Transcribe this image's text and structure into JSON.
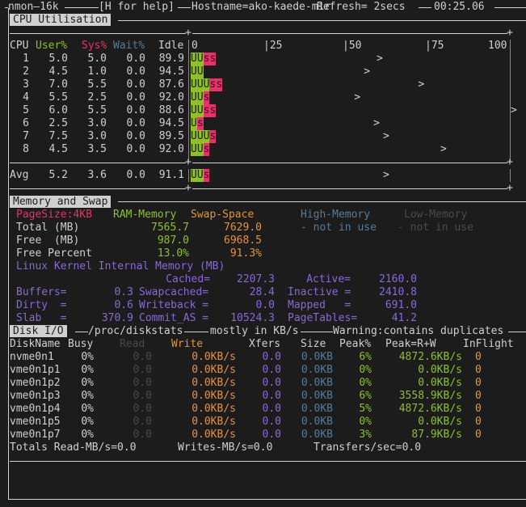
{
  "titlebar": {
    "app": "nmon—16k",
    "help": "[H for help]",
    "hostname": "Hostname=ako-kaede-mir",
    "refresh": "Refresh= 2secs",
    "time": "00:25.06"
  },
  "cpu": {
    "section_title": "CPU Utilisation",
    "headers": {
      "cpu": "CPU",
      "user": "User%",
      "sys": "Sys%",
      "wait": "Wait%",
      "idle": "Idle"
    },
    "scale": [
      "0",
      "|25",
      "|50",
      "|75",
      "100"
    ],
    "rows": [
      {
        "cpu": "1",
        "user": "5.0",
        "sys": "5.0",
        "wait": "0.0",
        "idle": "89.9",
        "bar_u": "UU",
        "bar_s": "ss",
        "peak_pct": 59
      },
      {
        "cpu": "2",
        "user": "4.5",
        "sys": "1.0",
        "wait": "0.0",
        "idle": "94.5",
        "bar_u": "UU",
        "bar_s": "",
        "peak_pct": 55
      },
      {
        "cpu": "3",
        "user": "7.0",
        "sys": "5.5",
        "wait": "0.0",
        "idle": "87.6",
        "bar_u": "UUU",
        "bar_s": "ss",
        "peak_pct": 72
      },
      {
        "cpu": "4",
        "user": "5.5",
        "sys": "2.5",
        "wait": "0.0",
        "idle": "92.0",
        "bar_u": "UU",
        "bar_s": "s",
        "peak_pct": 52
      },
      {
        "cpu": "5",
        "user": "6.0",
        "sys": "5.5",
        "wait": "0.0",
        "idle": "88.6",
        "bar_u": "UU",
        "bar_s": "ss",
        "peak_pct": 101
      },
      {
        "cpu": "6",
        "user": "2.5",
        "sys": "3.0",
        "wait": "0.0",
        "idle": "94.5",
        "bar_u": "U",
        "bar_s": "s",
        "peak_pct": 58
      },
      {
        "cpu": "7",
        "user": "7.5",
        "sys": "3.0",
        "wait": "0.0",
        "idle": "89.5",
        "bar_u": "UUU",
        "bar_s": "s",
        "peak_pct": 61
      },
      {
        "cpu": "8",
        "user": "4.5",
        "sys": "3.5",
        "wait": "0.0",
        "idle": "92.0",
        "bar_u": "UU",
        "bar_s": "s",
        "peak_pct": 79
      }
    ],
    "avg": {
      "label": "Avg",
      "user": "5.2",
      "sys": "3.6",
      "wait": "0.0",
      "idle": "91.1",
      "bar_u": "UU",
      "bar_s": "s",
      "peak_pct": 61
    },
    "peak_marker": ">"
  },
  "memory": {
    "section_title": "Memory and Swap",
    "pagesize": "PageSize:4KB",
    "ram_header": "RAM-Memory",
    "swap_header": "Swap-Space",
    "high_header": "High-Memory",
    "low_header": "Low-Memory",
    "high_value": "- not in use",
    "low_value": "- not in use",
    "rows": [
      {
        "label": "Total (MB)",
        "ram": "7565.7",
        "swap": "7629.0"
      },
      {
        "label": "Free  (MB)",
        "ram": "987.0",
        "swap": "6968.5"
      },
      {
        "label": "Free Percent",
        "ram": "13.0%",
        "swap": "91.3%"
      }
    ],
    "kernel_title": "Linux Kernel Internal Memory (MB)",
    "kernel": [
      [
        {
          "label": "",
          "value": ""
        },
        {
          "label": "Cached=",
          "value": "2207.3"
        },
        {
          "label": "Active=",
          "value": "2160.0"
        }
      ],
      [
        {
          "label": "Buffers=",
          "value": "0.3"
        },
        {
          "label": "Swapcached=",
          "value": "28.4"
        },
        {
          "label": "Inactive =",
          "value": "2410.8"
        }
      ],
      [
        {
          "label": "Dirty  =",
          "value": "0.6"
        },
        {
          "label": "Writeback =",
          "value": "0.0"
        },
        {
          "label": "Mapped   =",
          "value": "691.0"
        }
      ],
      [
        {
          "label": "Slab   =",
          "value": "370.9"
        },
        {
          "label": "Commit_AS =",
          "value": "10524.3"
        },
        {
          "label": "PageTables=",
          "value": "41.2"
        }
      ]
    ]
  },
  "disk": {
    "section_title": "Disk I/O",
    "source": "/proc/diskstats",
    "units": "mostly in KB/s",
    "warning": "Warning:contains duplicates",
    "headers": {
      "name": "DiskName",
      "busy": "Busy",
      "read": "Read",
      "write": "Write",
      "xfers": "Xfers",
      "size": "Size",
      "peak": "Peak%",
      "peakrw": "Peak=R+W",
      "inflight": "InFlight"
    },
    "rows": [
      {
        "name": "nvme0n1",
        "busy": "0%",
        "read": "0.0",
        "write": "0.0KB/s",
        "xfers": "0.0",
        "size": "0.0KB",
        "peak": "6%",
        "peakrw": "4872.6KB/s",
        "inflight": "0"
      },
      {
        "name": "vme0n1p1",
        "busy": "0%",
        "read": "0.0",
        "write": "0.0KB/s",
        "xfers": "0.0",
        "size": "0.0KB",
        "peak": "0%",
        "peakrw": "0.0KB/s",
        "inflight": "0"
      },
      {
        "name": "vme0n1p2",
        "busy": "0%",
        "read": "0.0",
        "write": "0.0KB/s",
        "xfers": "0.0",
        "size": "0.0KB",
        "peak": "0%",
        "peakrw": "0.0KB/s",
        "inflight": "0"
      },
      {
        "name": "vme0n1p3",
        "busy": "0%",
        "read": "0.0",
        "write": "0.0KB/s",
        "xfers": "0.0",
        "size": "0.0KB",
        "peak": "6%",
        "peakrw": "3558.9KB/s",
        "inflight": "0"
      },
      {
        "name": "vme0n1p4",
        "busy": "0%",
        "read": "0.0",
        "write": "0.0KB/s",
        "xfers": "0.0",
        "size": "0.0KB",
        "peak": "5%",
        "peakrw": "4872.6KB/s",
        "inflight": "0"
      },
      {
        "name": "vme0n1p5",
        "busy": "0%",
        "read": "0.0",
        "write": "0.0KB/s",
        "xfers": "0.0",
        "size": "0.0KB",
        "peak": "0%",
        "peakrw": "0.0KB/s",
        "inflight": "0"
      },
      {
        "name": "vme0n1p7",
        "busy": "0%",
        "read": "0.0",
        "write": "0.0KB/s",
        "xfers": "0.0",
        "size": "0.0KB",
        "peak": "3%",
        "peakrw": "87.9KB/s",
        "inflight": "0"
      }
    ],
    "totals": {
      "read": "Totals Read-MB/s=0.0",
      "writes": "Writes-MB/s=0.0",
      "transfers": "Transfers/sec=0.0"
    }
  }
}
